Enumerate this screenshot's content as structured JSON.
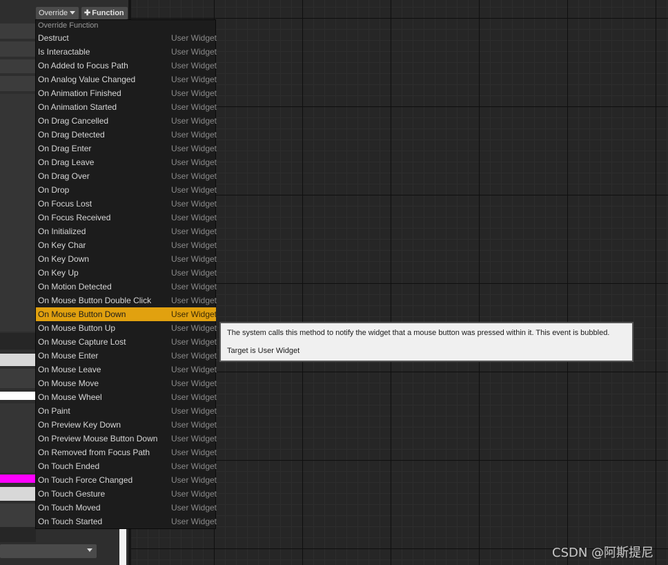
{
  "toolbar": {
    "override_label": "Override",
    "function_label": "Function"
  },
  "menu": {
    "header": "Override Function",
    "items": [
      {
        "label": "Destruct",
        "category": "User Widget"
      },
      {
        "label": "Is Interactable",
        "category": "User Widget"
      },
      {
        "label": "On Added to Focus Path",
        "category": "User Widget"
      },
      {
        "label": "On Analog Value Changed",
        "category": "User Widget"
      },
      {
        "label": "On Animation Finished",
        "category": "User Widget"
      },
      {
        "label": "On Animation Started",
        "category": "User Widget"
      },
      {
        "label": "On Drag Cancelled",
        "category": "User Widget"
      },
      {
        "label": "On Drag Detected",
        "category": "User Widget"
      },
      {
        "label": "On Drag Enter",
        "category": "User Widget"
      },
      {
        "label": "On Drag Leave",
        "category": "User Widget"
      },
      {
        "label": "On Drag Over",
        "category": "User Widget"
      },
      {
        "label": "On Drop",
        "category": "User Widget"
      },
      {
        "label": "On Focus Lost",
        "category": "User Widget"
      },
      {
        "label": "On Focus Received",
        "category": "User Widget"
      },
      {
        "label": "On Initialized",
        "category": "User Widget"
      },
      {
        "label": "On Key Char",
        "category": "User Widget"
      },
      {
        "label": "On Key Down",
        "category": "User Widget"
      },
      {
        "label": "On Key Up",
        "category": "User Widget"
      },
      {
        "label": "On Motion Detected",
        "category": "User Widget"
      },
      {
        "label": "On Mouse Button Double Click",
        "category": "User Widget"
      },
      {
        "label": "On Mouse Button Down",
        "category": "User Widget"
      },
      {
        "label": "On Mouse Button Up",
        "category": "User Widget"
      },
      {
        "label": "On Mouse Capture Lost",
        "category": "User Widget"
      },
      {
        "label": "On Mouse Enter",
        "category": "User Widget"
      },
      {
        "label": "On Mouse Leave",
        "category": "User Widget"
      },
      {
        "label": "On Mouse Move",
        "category": "User Widget"
      },
      {
        "label": "On Mouse Wheel",
        "category": "User Widget"
      },
      {
        "label": "On Paint",
        "category": "User Widget"
      },
      {
        "label": "On Preview Key Down",
        "category": "User Widget"
      },
      {
        "label": "On Preview Mouse Button Down",
        "category": "User Widget"
      },
      {
        "label": "On Removed from Focus Path",
        "category": "User Widget"
      },
      {
        "label": "On Touch Ended",
        "category": "User Widget"
      },
      {
        "label": "On Touch Force Changed",
        "category": "User Widget"
      },
      {
        "label": "On Touch Gesture",
        "category": "User Widget"
      },
      {
        "label": "On Touch Moved",
        "category": "User Widget"
      },
      {
        "label": "On Touch Started",
        "category": "User Widget"
      }
    ],
    "selected_label": "On Mouse Button Down"
  },
  "tooltip": {
    "description": "The system calls this method to notify the widget that a mouse button was pressed within it. This event is bubbled.",
    "target": "Target is User Widget"
  },
  "watermark": "CSDN @阿斯提尼",
  "colors": {
    "selection": "#e1a10f",
    "graph_background": "#262626",
    "menu_background": "#1c1c1c",
    "tooltip_background": "#f0f0f0"
  }
}
